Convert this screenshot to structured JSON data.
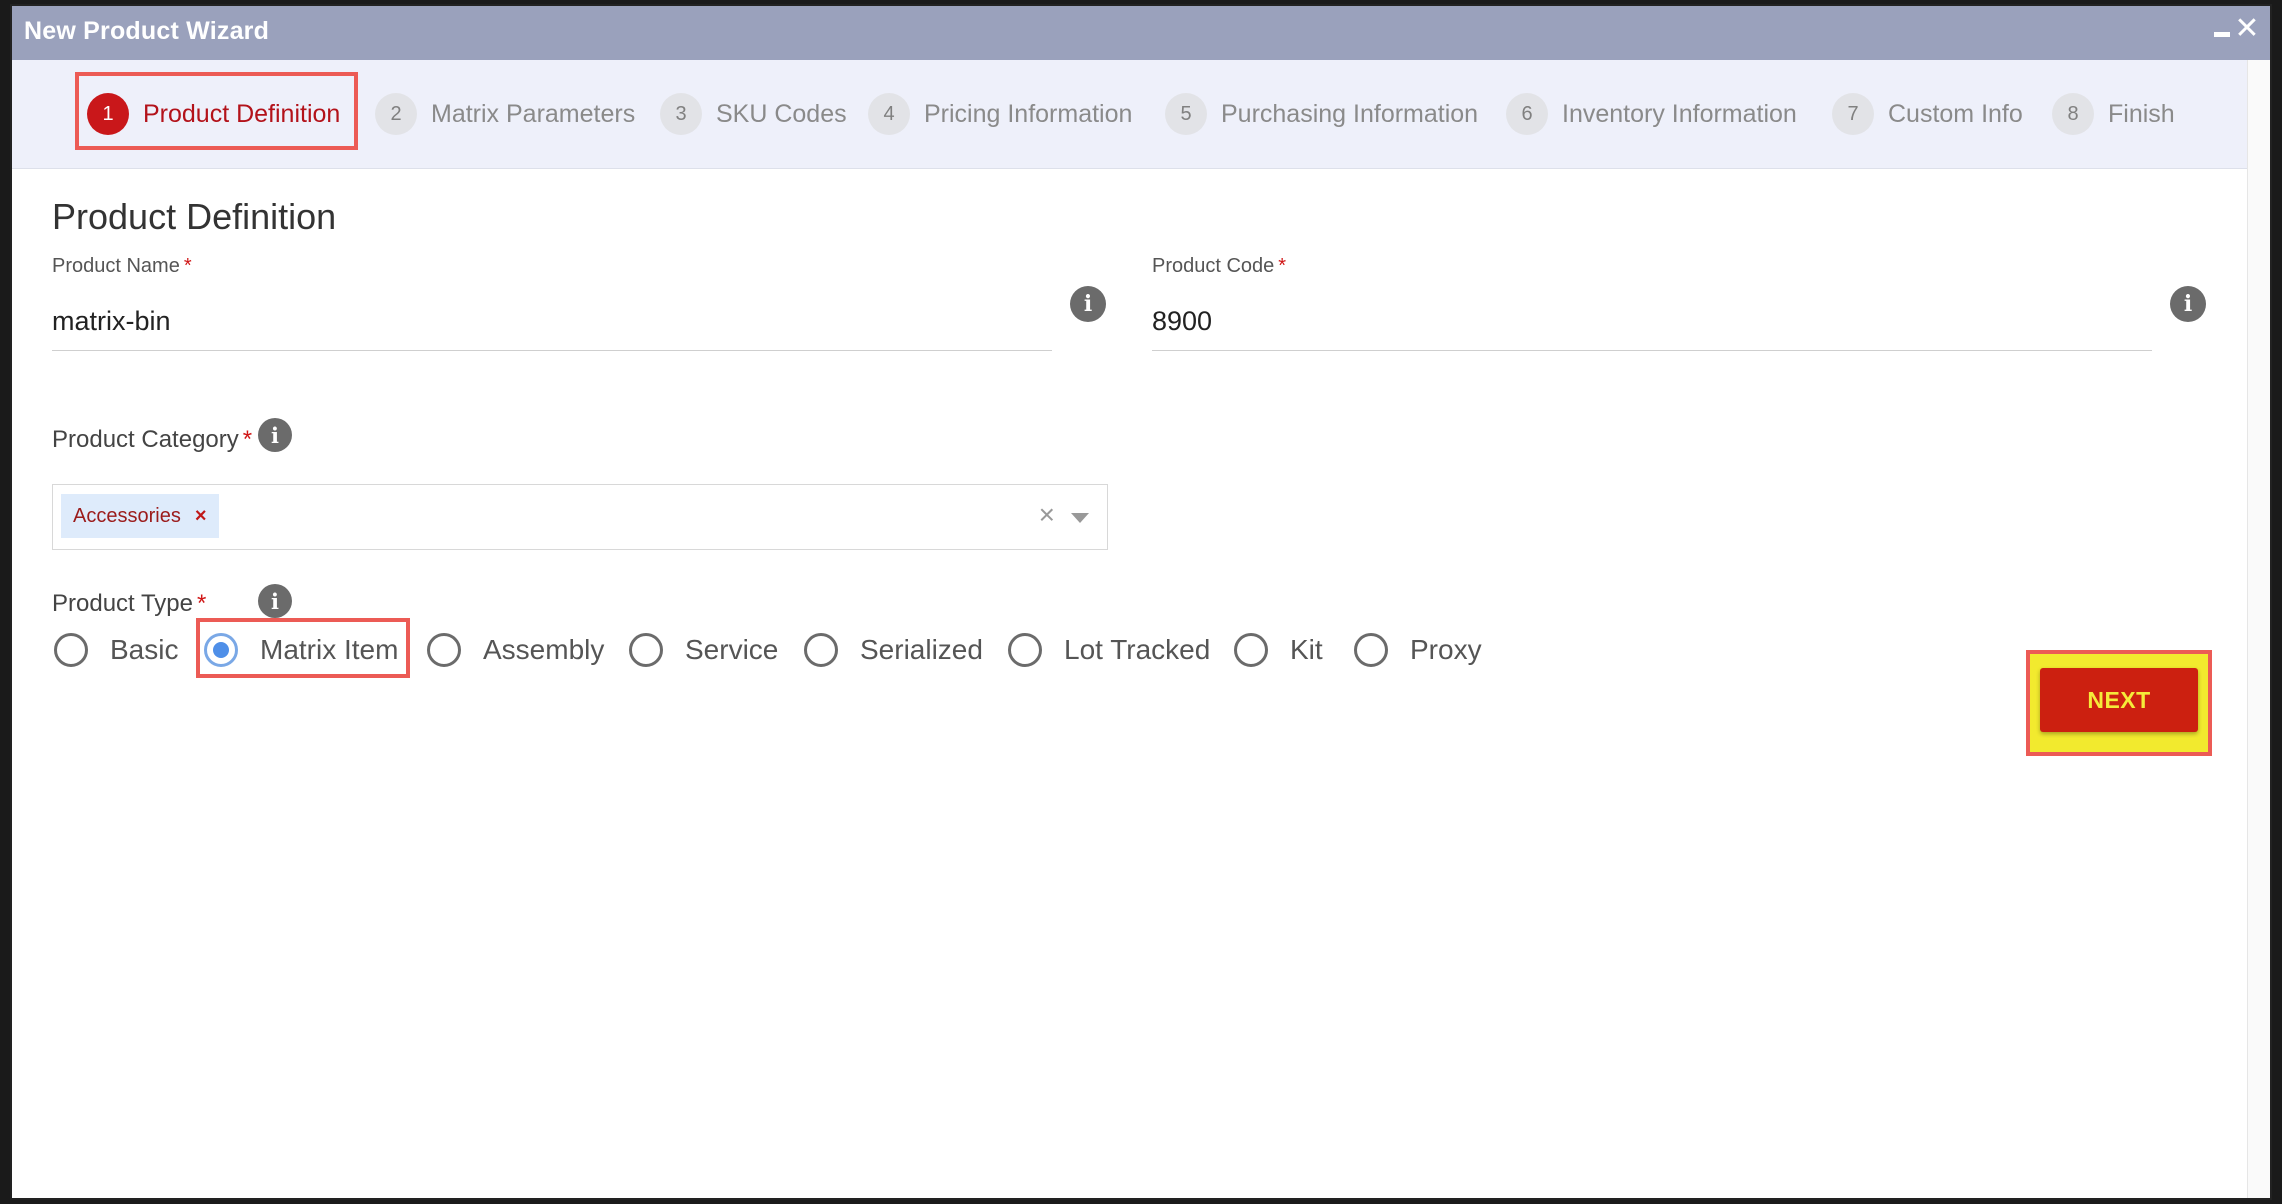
{
  "window": {
    "title": "New Product Wizard",
    "minimize_icon": "minimize-icon",
    "close_glyph": "✕"
  },
  "steps": [
    {
      "num": "1",
      "label": "Product Definition",
      "active": true
    },
    {
      "num": "2",
      "label": "Matrix Parameters",
      "active": false
    },
    {
      "num": "3",
      "label": "SKU Codes",
      "active": false
    },
    {
      "num": "4",
      "label": "Pricing Information",
      "active": false
    },
    {
      "num": "5",
      "label": "Purchasing Information",
      "active": false
    },
    {
      "num": "6",
      "label": "Inventory Information",
      "active": false
    },
    {
      "num": "7",
      "label": "Custom Info",
      "active": false
    },
    {
      "num": "8",
      "label": "Finish",
      "active": false
    }
  ],
  "form": {
    "heading": "Product Definition",
    "required_mark": "*",
    "info_glyph": "i",
    "product_name": {
      "label": "Product Name",
      "value": "matrix-bin"
    },
    "product_code": {
      "label": "Product Code",
      "value": "8900"
    },
    "product_category": {
      "label": "Product Category",
      "selected": "Accessories",
      "chip_remove": "×",
      "clear": "×"
    },
    "product_type": {
      "label": "Product Type",
      "options": [
        "Basic",
        "Matrix Item",
        "Assembly",
        "Service",
        "Serialized",
        "Lot Tracked",
        "Kit",
        "Proxy"
      ],
      "selected": "Matrix Item"
    }
  },
  "next_button": {
    "label": "NEXT"
  },
  "colors": {
    "accent_red": "#c9171a",
    "highlight_border": "#ec5b55",
    "highlight_fill": "#f2ea2e",
    "titlebar": "#9aa1bc",
    "radio_selected": "#4f8fe8"
  }
}
